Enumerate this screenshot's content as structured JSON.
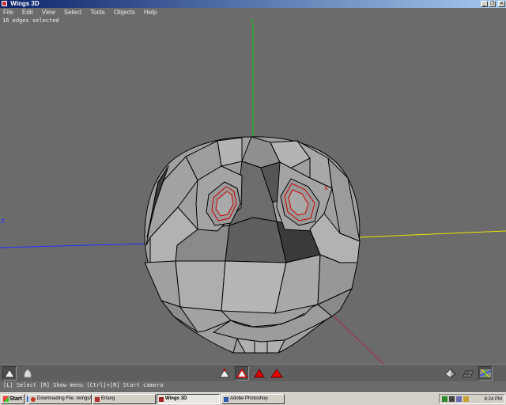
{
  "window": {
    "title": "Wings 3D"
  },
  "menu": [
    "File",
    "Edit",
    "View",
    "Select",
    "Tools",
    "Objects",
    "Help"
  ],
  "status": {
    "selection": "16 edges selected"
  },
  "viewport": {
    "axis_y_label": "Y",
    "axis_z_label": "Z",
    "axis_x_label": "X"
  },
  "infoline": {
    "text": "[L] Select  [R] Show menu  [Ctrl]+[R] Start camera"
  },
  "toolbar": {
    "left": [
      "smooth-shade-icon",
      "material-icon"
    ],
    "select_modes": [
      "vertex-mode-icon",
      "edge-mode-icon",
      "face-mode-icon",
      "object-mode-icon"
    ],
    "right": [
      "orthographic-icon",
      "ground-grid-icon",
      "axes-icon"
    ]
  },
  "taskbar": {
    "start_label": "Start",
    "tasks": [
      {
        "label": "Downloading File: /wings/...",
        "icon": "opera-icon",
        "color": "#c0392b"
      },
      {
        "label": "Erlang",
        "icon": "erlang-icon",
        "color": "#b03030"
      },
      {
        "label": "Wings 3D",
        "icon": "wings-icon",
        "color": "#a02020",
        "active": true
      },
      {
        "label": "Adobe Photoshop",
        "icon": "photoshop-icon",
        "color": "#2a5caa"
      }
    ],
    "clock": "6:24 PM"
  },
  "colors": {
    "mesh_fill": "#a3a3a3",
    "mesh_edge": "#000000",
    "selected_edge": "#cc0000",
    "axis_x": "#e8e800",
    "axis_y": "#00cc00",
    "axis_z": "#2030ff"
  }
}
